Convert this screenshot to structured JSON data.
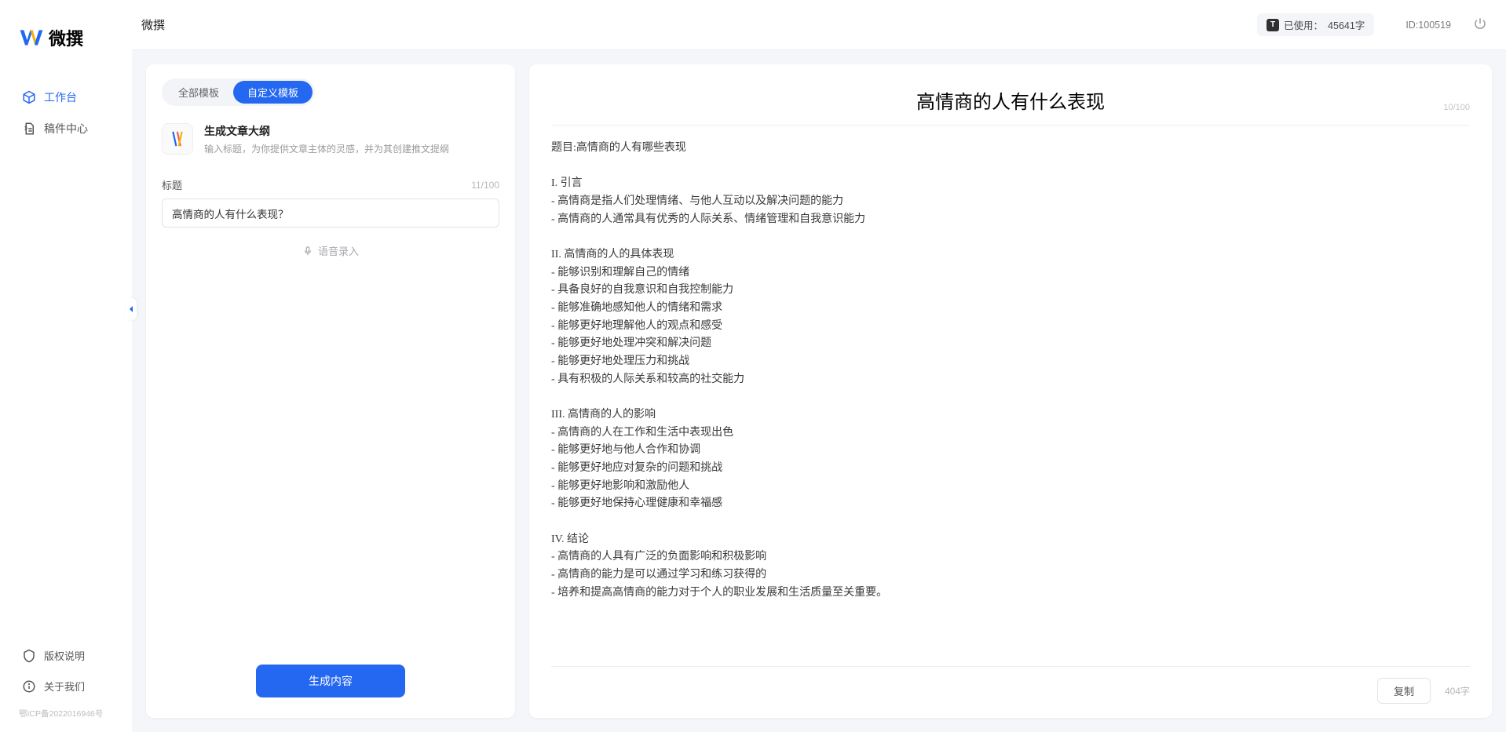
{
  "app": {
    "brand": "微撰",
    "topbarTitle": "微撰"
  },
  "sidebar": {
    "items": [
      {
        "label": "工作台",
        "active": true
      },
      {
        "label": "稿件中心",
        "active": false
      }
    ],
    "footer": [
      {
        "label": "版权说明"
      },
      {
        "label": "关于我们"
      }
    ],
    "icp": "鄂ICP备2022016946号"
  },
  "topbar": {
    "usagePrefix": "已使用：",
    "usageValue": "45641字",
    "userIdLabel": "ID:100519"
  },
  "left": {
    "tabs": [
      "全部模板",
      "自定义模板"
    ],
    "activeTab": 1,
    "template": {
      "title": "生成文章大纲",
      "desc": "输入标题，为你提供文章主体的灵感，并为其创建推文提纲"
    },
    "form": {
      "label": "标题",
      "value": "高情商的人有什么表现？",
      "charCount": "11/100"
    },
    "voiceInput": "语音录入",
    "generate": "生成内容"
  },
  "output": {
    "title": "高情商的人有什么表现",
    "titleCount": "10/100",
    "body": "题目:高情商的人有哪些表现\n\nI. 引言\n- 高情商是指人们处理情绪、与他人互动以及解决问题的能力\n- 高情商的人通常具有优秀的人际关系、情绪管理和自我意识能力\n\nII. 高情商的人的具体表现\n- 能够识别和理解自己的情绪\n- 具备良好的自我意识和自我控制能力\n- 能够准确地感知他人的情绪和需求\n- 能够更好地理解他人的观点和感受\n- 能够更好地处理冲突和解决问题\n- 能够更好地处理压力和挑战\n- 具有积极的人际关系和较高的社交能力\n\nIII. 高情商的人的影响\n- 高情商的人在工作和生活中表现出色\n- 能够更好地与他人合作和协调\n- 能够更好地应对复杂的问题和挑战\n- 能够更好地影响和激励他人\n- 能够更好地保持心理健康和幸福感\n\nIV. 结论\n- 高情商的人具有广泛的负面影响和积极影响\n- 高情商的能力是可以通过学习和练习获得的\n- 培养和提高高情商的能力对于个人的职业发展和生活质量至关重要。",
    "copy": "复制",
    "wordCount": "404字"
  }
}
